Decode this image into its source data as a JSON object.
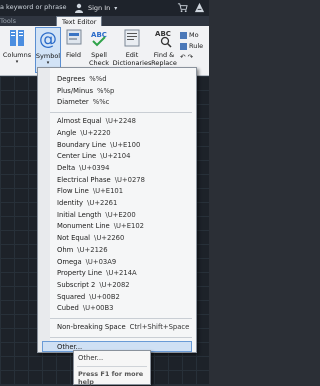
{
  "titlebar": {
    "search_text": "a keyword or phrase",
    "signin_label": "Sign In"
  },
  "tabs": [
    {
      "label": "Tools"
    },
    {
      "label": "Text Editor"
    }
  ],
  "ribbon": {
    "columns": "Columns",
    "symbol": "Symbol",
    "field": "Field",
    "spell_check": [
      "Spell",
      "Check"
    ],
    "edit_dictionaries": [
      "Edit",
      "Dictionaries"
    ],
    "find_replace": [
      "Find &",
      "Replace"
    ],
    "side": [
      "Mo",
      "Rule"
    ],
    "find_icon_text": "ABC"
  },
  "symbol_menu": {
    "groups": [
      [
        {
          "name": "Degrees",
          "code": "%%d"
        },
        {
          "name": "Plus/Minus",
          "code": "%%p"
        },
        {
          "name": "Diameter",
          "code": "%%c"
        }
      ],
      [
        {
          "name": "Almost Equal",
          "code": "\\U+2248"
        },
        {
          "name": "Angle",
          "code": "\\U+2220"
        },
        {
          "name": "Boundary Line",
          "code": "\\U+E100"
        },
        {
          "name": "Center Line",
          "code": "\\U+2104"
        },
        {
          "name": "Delta",
          "code": "\\U+0394"
        },
        {
          "name": "Electrical Phase",
          "code": "\\U+0278"
        },
        {
          "name": "Flow Line",
          "code": "\\U+E101"
        },
        {
          "name": "Identity",
          "code": "\\U+2261"
        },
        {
          "name": "Initial Length",
          "code": "\\U+E200"
        },
        {
          "name": "Monument Line",
          "code": "\\U+E102"
        },
        {
          "name": "Not Equal",
          "code": "\\U+2260"
        },
        {
          "name": "Ohm",
          "code": "\\U+2126"
        },
        {
          "name": "Omega",
          "code": "\\U+03A9"
        },
        {
          "name": "Property Line",
          "code": "\\U+214A"
        },
        {
          "name": "Subscript 2",
          "code": "\\U+2082"
        },
        {
          "name": "Squared",
          "code": "\\U+00B2"
        },
        {
          "name": "Cubed",
          "code": "\\U+00B3"
        }
      ],
      [
        {
          "name": "Non-breaking Space",
          "code": "Ctrl+Shift+Space"
        }
      ],
      [
        {
          "name": "Other...",
          "code": ""
        }
      ]
    ]
  },
  "tooltip": {
    "title": "Other...",
    "help": "Press F1 for more help"
  }
}
